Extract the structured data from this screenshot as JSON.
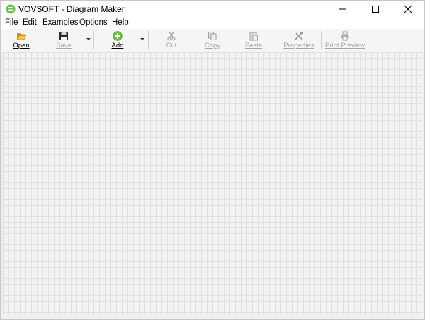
{
  "window": {
    "title": "VOVSOFT - Diagram Maker"
  },
  "menu": [
    "File",
    "Edit",
    "Examples",
    "Options",
    "Help"
  ],
  "toolbar": {
    "open": "Open",
    "save": "Save",
    "add": "Add",
    "cut": "Cut",
    "copy": "Copy",
    "paste": "Paste",
    "properties": "Properties",
    "print_preview": "Print Preview"
  },
  "icons": {
    "app": "diagram-maker-app-icon",
    "open": "folder-open-icon",
    "save": "floppy-disk-icon",
    "add": "green-plus-circle-icon",
    "cut": "scissors-icon",
    "copy": "copy-icon",
    "paste": "clipboard-icon",
    "properties": "tools-icon",
    "print_preview": "printer-icon"
  },
  "colors": {
    "accent_green": "#6cc24a",
    "disabled_text": "#a6a6a6",
    "canvas_background": "#f3f3f3",
    "grid_line": "#e0e0e0"
  }
}
